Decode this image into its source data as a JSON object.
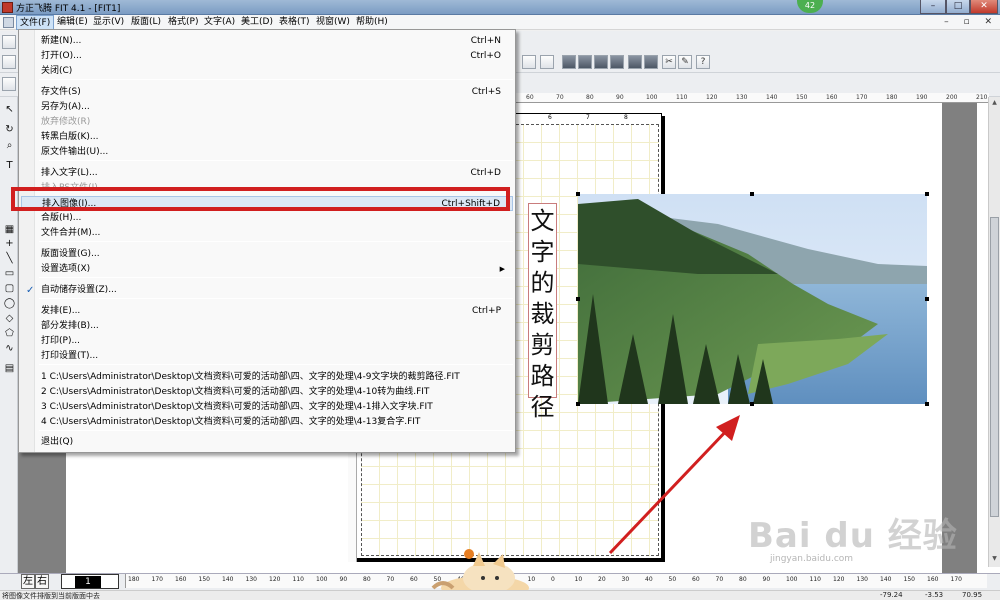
{
  "window": {
    "title": "方正飞腾 FIT 4.1 - [FIT1]",
    "ime_badge": "42"
  },
  "menubar": {
    "items": [
      "文件(F)",
      "编辑(E)",
      "显示(V)",
      "版面(L)",
      "格式(P)",
      "文字(A)",
      "美工(D)",
      "表格(T)",
      "视窗(W)",
      "帮助(H)"
    ]
  },
  "file_menu": {
    "items": [
      {
        "label": "新建(N)...",
        "shortcut": "Ctrl+N"
      },
      {
        "label": "打开(O)...",
        "shortcut": "Ctrl+O"
      },
      {
        "label": "关闭(C)",
        "shortcut": ""
      },
      {
        "label": "存文件(S)",
        "shortcut": "Ctrl+S"
      },
      {
        "label": "另存为(A)...",
        "shortcut": ""
      },
      {
        "label": "放弃修改(R)",
        "shortcut": ""
      },
      {
        "label": "转黑白版(K)...",
        "shortcut": ""
      },
      {
        "label": "原文件输出(U)...",
        "shortcut": ""
      },
      {
        "label": "排入文字(L)...",
        "shortcut": "Ctrl+D"
      },
      {
        "label": "排入PS文件(I)",
        "shortcut": ""
      },
      {
        "label": "排入图像(I)...",
        "shortcut": "Ctrl+Shift+D"
      },
      {
        "label": "合版(H)...",
        "shortcut": ""
      },
      {
        "label": "文件合并(M)...",
        "shortcut": ""
      },
      {
        "label": "版面设置(G)...",
        "shortcut": ""
      },
      {
        "label": "设置选项(X)",
        "shortcut": ""
      },
      {
        "label": "自动储存设置(Z)...",
        "shortcut": ""
      },
      {
        "label": "发排(E)...",
        "shortcut": "Ctrl+P"
      },
      {
        "label": "部分发排(B)...",
        "shortcut": ""
      },
      {
        "label": "打印(P)...",
        "shortcut": ""
      },
      {
        "label": "打印设置(T)...",
        "shortcut": ""
      },
      {
        "label": "1 C:\\Users\\Administrator\\Desktop\\文档资料\\可爱的活动部\\四、文字的处理\\4-9文字块的裁剪路径.FIT",
        "shortcut": ""
      },
      {
        "label": "2 C:\\Users\\Administrator\\Desktop\\文档资料\\可爱的活动部\\四、文字的处理\\4-10转为曲线.FIT",
        "shortcut": ""
      },
      {
        "label": "3 C:\\Users\\Administrator\\Desktop\\文档资料\\可爱的活动部\\四、文字的处理\\4-1排入文字块.FIT",
        "shortcut": ""
      },
      {
        "label": "4 C:\\Users\\Administrator\\Desktop\\文档资料\\可爱的活动部\\四、文字的处理\\4-13复合字.FIT",
        "shortcut": ""
      },
      {
        "label": "退出(Q)",
        "shortcut": ""
      }
    ]
  },
  "canvas": {
    "vertical_text": "文字的裁剪路径",
    "ruler_top": [
      "60",
      "70",
      "80",
      "90",
      "100",
      "110",
      "120",
      "130",
      "140",
      "150",
      "160",
      "170",
      "180",
      "190",
      "200",
      "210"
    ],
    "page_ruler": [
      "6",
      "7",
      "8"
    ]
  },
  "bottom": {
    "left_btn": "左",
    "right_btn": "右",
    "page_num": "1",
    "ruler": [
      "180",
      "170",
      "160",
      "150",
      "140",
      "130",
      "120",
      "110",
      "100",
      "90",
      "80",
      "70",
      "60",
      "50",
      "40",
      "30",
      "20",
      "10",
      "0",
      "10",
      "20",
      "30",
      "40",
      "50",
      "60",
      "70",
      "80",
      "90",
      "100",
      "110",
      "120",
      "130",
      "140",
      "150",
      "160",
      "170"
    ]
  },
  "status": {
    "message": "将图像文件排版到当前版面中去",
    "x": "-79.24",
    "y": "-3.53",
    "zoom": "70.95"
  },
  "watermark": {
    "text": "Bai du 经验",
    "sub": "jingyan.baidu.com"
  },
  "colors": {
    "highlight_box": "#d11f1f",
    "arrow": "#d11f1f",
    "title_bar": "#7b9cc3"
  }
}
